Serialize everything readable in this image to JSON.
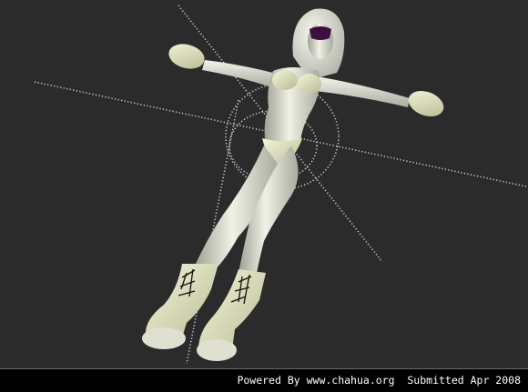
{
  "viewport": {
    "background": "#2b2b2b",
    "model_color": "#e6e7d8",
    "model_shadow": "#9ea095",
    "clothing_color": "#e9ebc6",
    "guide_color": "#cfcfcf",
    "lace_color": "#111111",
    "visor_color": "#3b1040"
  },
  "footer": {
    "text": "Powered By www.chahua.org  Submitted Apr 2008"
  }
}
